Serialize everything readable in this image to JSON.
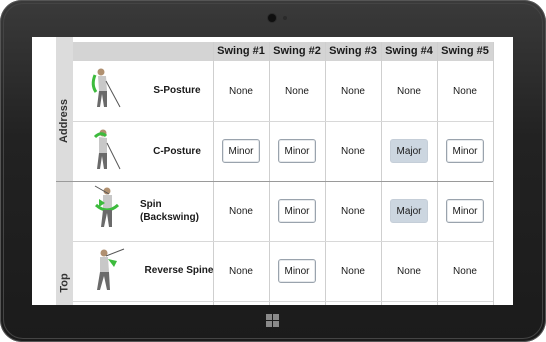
{
  "table": {
    "columns": [
      "Swing #1",
      "Swing #2",
      "Swing #3",
      "Swing #4",
      "Swing #5"
    ],
    "groups": [
      {
        "label": "Address"
      },
      {
        "label": "Top"
      }
    ],
    "rows": [
      {
        "label": "S-Posture",
        "cells": [
          {
            "value": "None",
            "style": "text"
          },
          {
            "value": "None",
            "style": "text"
          },
          {
            "value": "None",
            "style": "text"
          },
          {
            "value": "None",
            "style": "text"
          },
          {
            "value": "None",
            "style": "text"
          }
        ]
      },
      {
        "label": "C-Posture",
        "cells": [
          {
            "value": "Minor",
            "style": "minor"
          },
          {
            "value": "Minor",
            "style": "minor"
          },
          {
            "value": "None",
            "style": "text"
          },
          {
            "value": "Major",
            "style": "major"
          },
          {
            "value": "Minor",
            "style": "minor"
          }
        ]
      },
      {
        "label": "Spin\n(Backswing)",
        "cells": [
          {
            "value": "None",
            "style": "text"
          },
          {
            "value": "Minor",
            "style": "minor"
          },
          {
            "value": "None",
            "style": "text"
          },
          {
            "value": "Major",
            "style": "major"
          },
          {
            "value": "Minor",
            "style": "minor"
          }
        ]
      },
      {
        "label": "Reverse Spine",
        "cells": [
          {
            "value": "None",
            "style": "text"
          },
          {
            "value": "Minor",
            "style": "minor"
          },
          {
            "value": "None",
            "style": "text"
          },
          {
            "value": "None",
            "style": "text"
          },
          {
            "value": "None",
            "style": "text"
          }
        ]
      }
    ]
  },
  "colors": {
    "accent_green": "#3dbb3d",
    "major_fill": "#ccd6e0",
    "header_fill": "#d4d4d4"
  },
  "icons": [
    "camera-icon",
    "windows-logo-icon",
    "golfer-figure-icon"
  ]
}
